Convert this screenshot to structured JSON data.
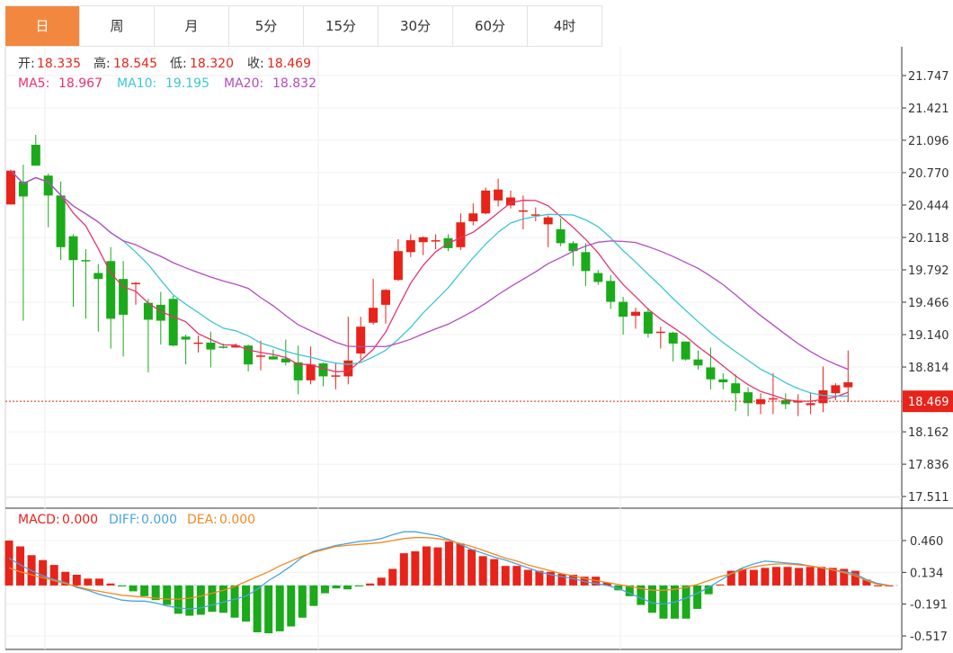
{
  "tabs": [
    {
      "label": "日",
      "active": true
    },
    {
      "label": "周",
      "active": false
    },
    {
      "label": "月",
      "active": false
    },
    {
      "label": "5分",
      "active": false
    },
    {
      "label": "15分",
      "active": false
    },
    {
      "label": "30分",
      "active": false
    },
    {
      "label": "60分",
      "active": false
    },
    {
      "label": "4时",
      "active": false
    }
  ],
  "ohlc_info": {
    "open_label": "开:",
    "open": "18.335",
    "high_label": "高:",
    "high": "18.545",
    "low_label": "低:",
    "low": "18.320",
    "close_label": "收:",
    "close": "18.469"
  },
  "ma_info": {
    "ma5_label": "MA5:",
    "ma5": "18.967",
    "ma10_label": "MA10:",
    "ma10": "19.195",
    "ma20_label": "MA20:",
    "ma20": "18.832"
  },
  "macd_info": {
    "macd_label": "MACD:",
    "macd": "0.000",
    "diff_label": "DIFF:",
    "diff": "0.000",
    "dea_label": "DEA:",
    "dea": "0.000"
  },
  "colors": {
    "up": "#e8231a",
    "down": "#1aaa1a",
    "ma5": "#e8336e",
    "ma10": "#3cc6d4",
    "ma20": "#b14cc0",
    "diff": "#4aa3e0",
    "dea": "#f08a24",
    "tab_active": "#f2883f",
    "price_line": "#e8231a"
  },
  "chart_data": [
    {
      "type": "candlestick",
      "price_axis_ticks": [
        "21.747",
        "21.421",
        "21.096",
        "20.770",
        "20.444",
        "20.118",
        "19.792",
        "19.466",
        "19.140",
        "18.814",
        "18.162",
        "17.836",
        "17.511"
      ],
      "ylim": [
        17.511,
        21.747
      ],
      "last_price": "18.469",
      "candles": [
        [
          20.45,
          20.79,
          20.45,
          20.8
        ],
        [
          20.68,
          20.53,
          19.28,
          20.85
        ],
        [
          21.05,
          20.84,
          20.94,
          21.15
        ],
        [
          20.74,
          20.54,
          20.22,
          20.76
        ],
        [
          20.54,
          20.02,
          19.89,
          20.68
        ],
        [
          20.13,
          19.89,
          19.42,
          20.15
        ],
        [
          19.89,
          19.88,
          19.3,
          20.0
        ],
        [
          19.76,
          19.7,
          19.17,
          19.85
        ],
        [
          19.88,
          19.3,
          19.0,
          20.02
        ],
        [
          19.7,
          19.34,
          18.92,
          19.88
        ],
        [
          19.65,
          19.66,
          19.44,
          19.67
        ],
        [
          19.46,
          19.29,
          18.76,
          19.5
        ],
        [
          19.44,
          19.28,
          19.04,
          19.57
        ],
        [
          19.5,
          19.03,
          19.02,
          19.53
        ],
        [
          19.12,
          19.09,
          18.84,
          19.14
        ],
        [
          19.05,
          19.06,
          18.96,
          19.13
        ],
        [
          19.06,
          18.99,
          18.81,
          19.17
        ],
        [
          19.02,
          19.01,
          19.0,
          19.05
        ],
        [
          19.01,
          19.03,
          19.01,
          19.05
        ],
        [
          19.03,
          18.84,
          18.77,
          19.04
        ],
        [
          18.92,
          18.93,
          18.78,
          19.08
        ],
        [
          18.92,
          18.89,
          18.89,
          18.99
        ],
        [
          18.9,
          18.86,
          18.83,
          19.09
        ],
        [
          18.86,
          18.68,
          18.54,
          19.03
        ],
        [
          18.68,
          18.84,
          18.64,
          19.02
        ],
        [
          18.85,
          18.72,
          18.62,
          18.86
        ],
        [
          18.73,
          18.73,
          18.59,
          18.86
        ],
        [
          18.72,
          18.88,
          18.64,
          19.32
        ],
        [
          18.95,
          19.22,
          18.89,
          19.32
        ],
        [
          19.26,
          19.41,
          19.24,
          19.7
        ],
        [
          19.44,
          19.59,
          19.25,
          19.6
        ],
        [
          19.69,
          19.98,
          19.68,
          20.1
        ],
        [
          19.97,
          20.09,
          19.92,
          20.15
        ],
        [
          20.07,
          20.12,
          19.94,
          20.13
        ],
        [
          20.09,
          20.09,
          20.0,
          20.15
        ],
        [
          20.11,
          20.01,
          19.98,
          20.15
        ],
        [
          20.02,
          20.27,
          19.99,
          20.36
        ],
        [
          20.28,
          20.36,
          20.24,
          20.46
        ],
        [
          20.36,
          20.59,
          20.35,
          20.62
        ],
        [
          20.49,
          20.6,
          20.43,
          20.71
        ],
        [
          20.44,
          20.52,
          20.41,
          20.59
        ],
        [
          20.39,
          20.39,
          20.2,
          20.54
        ],
        [
          20.35,
          20.35,
          20.28,
          20.42
        ],
        [
          20.25,
          20.32,
          20.02,
          20.34
        ],
        [
          20.2,
          20.06,
          20.03,
          20.31
        ],
        [
          20.06,
          19.98,
          19.83,
          20.08
        ],
        [
          19.97,
          19.78,
          19.63,
          20.06
        ],
        [
          19.76,
          19.67,
          19.64,
          19.79
        ],
        [
          19.68,
          19.47,
          19.4,
          19.74
        ],
        [
          19.47,
          19.32,
          19.14,
          19.52
        ],
        [
          19.33,
          19.37,
          19.2,
          19.41
        ],
        [
          19.37,
          19.15,
          19.11,
          19.41
        ],
        [
          19.16,
          19.17,
          19.0,
          19.22
        ],
        [
          19.16,
          19.05,
          18.87,
          19.17
        ],
        [
          19.07,
          18.89,
          18.88,
          19.07
        ],
        [
          18.89,
          18.83,
          18.79,
          18.98
        ],
        [
          18.81,
          18.69,
          18.59,
          19.01
        ],
        [
          18.69,
          18.66,
          18.59,
          18.75
        ],
        [
          18.65,
          18.55,
          18.37,
          18.74
        ],
        [
          18.56,
          18.45,
          18.32,
          18.61
        ],
        [
          18.44,
          18.49,
          18.34,
          18.55
        ],
        [
          18.5,
          18.5,
          18.34,
          18.75
        ],
        [
          18.48,
          18.44,
          18.39,
          18.55
        ],
        [
          18.46,
          18.47,
          18.32,
          18.54
        ],
        [
          18.43,
          18.45,
          18.34,
          18.55
        ],
        [
          18.45,
          18.58,
          18.36,
          18.82
        ],
        [
          18.55,
          18.63,
          18.48,
          18.65
        ],
        [
          18.61,
          18.66,
          18.46,
          18.98
        ]
      ],
      "note_candles": "each candle: [open, close, low, high] in price units"
    },
    {
      "type": "bar+line",
      "macd_axis_ticks": [
        "0.460",
        "0.134",
        "-0.191",
        "-0.517"
      ],
      "ylim": [
        -0.6,
        0.58
      ],
      "macd": [
        0.46,
        0.4,
        0.31,
        0.26,
        0.21,
        0.14,
        0.11,
        0.07,
        0.07,
        0.02,
        -0.01,
        -0.06,
        -0.11,
        -0.15,
        -0.2,
        -0.29,
        -0.31,
        -0.3,
        -0.27,
        -0.28,
        -0.33,
        -0.37,
        -0.48,
        -0.49,
        -0.47,
        -0.42,
        -0.33,
        -0.21,
        -0.08,
        -0.03,
        -0.04,
        -0.01,
        0.02,
        0.08,
        0.17,
        0.33,
        0.35,
        0.4,
        0.39,
        0.45,
        0.43,
        0.37,
        0.3,
        0.27,
        0.2,
        0.2,
        0.16,
        0.15,
        0.14,
        0.12,
        0.11,
        0.09,
        0.09,
        0.03,
        -0.05,
        -0.11,
        -0.2,
        -0.28,
        -0.34,
        -0.34,
        -0.34,
        -0.24,
        -0.09,
        0.01,
        0.15,
        0.17,
        0.16,
        0.18,
        0.19,
        0.19,
        0.18,
        0.19,
        0.19,
        0.18,
        0.17,
        0.15,
        0.06,
        0.0,
        0.0
      ],
      "diff": [
        0.28,
        0.21,
        0.15,
        0.1,
        0.06,
        0.03,
        -0.02,
        -0.05,
        -0.09,
        -0.12,
        -0.15,
        -0.16,
        -0.16,
        -0.18,
        -0.21,
        -0.23,
        -0.24,
        -0.23,
        -0.2,
        -0.17,
        -0.14,
        -0.11,
        -0.04,
        0.05,
        0.12,
        0.2,
        0.29,
        0.35,
        0.38,
        0.41,
        0.43,
        0.45,
        0.46,
        0.48,
        0.52,
        0.55,
        0.55,
        0.53,
        0.51,
        0.47,
        0.42,
        0.37,
        0.33,
        0.29,
        0.26,
        0.22,
        0.18,
        0.14,
        0.11,
        0.09,
        0.07,
        0.04,
        0.02,
        0.0,
        -0.03,
        -0.08,
        -0.13,
        -0.18,
        -0.19,
        -0.17,
        -0.13,
        -0.08,
        -0.02,
        0.05,
        0.12,
        0.18,
        0.22,
        0.25,
        0.24,
        0.23,
        0.22,
        0.2,
        0.18,
        0.16,
        0.14,
        0.12,
        0.06,
        0.02,
        0.0
      ],
      "dea": [
        0.18,
        0.14,
        0.11,
        0.08,
        0.05,
        0.02,
        -0.01,
        -0.04,
        -0.06,
        -0.08,
        -0.1,
        -0.11,
        -0.12,
        -0.13,
        -0.14,
        -0.14,
        -0.13,
        -0.11,
        -0.08,
        -0.05,
        -0.01,
        0.04,
        0.09,
        0.14,
        0.2,
        0.25,
        0.3,
        0.34,
        0.37,
        0.4,
        0.41,
        0.42,
        0.43,
        0.44,
        0.46,
        0.48,
        0.49,
        0.49,
        0.48,
        0.46,
        0.43,
        0.4,
        0.36,
        0.32,
        0.28,
        0.25,
        0.21,
        0.18,
        0.15,
        0.12,
        0.1,
        0.07,
        0.05,
        0.03,
        0.01,
        -0.01,
        -0.03,
        -0.05,
        -0.05,
        -0.04,
        -0.02,
        0.01,
        0.05,
        0.09,
        0.12,
        0.16,
        0.19,
        0.21,
        0.22,
        0.22,
        0.21,
        0.2,
        0.18,
        0.16,
        0.13,
        0.1,
        0.05,
        0.01,
        0.0
      ]
    }
  ]
}
